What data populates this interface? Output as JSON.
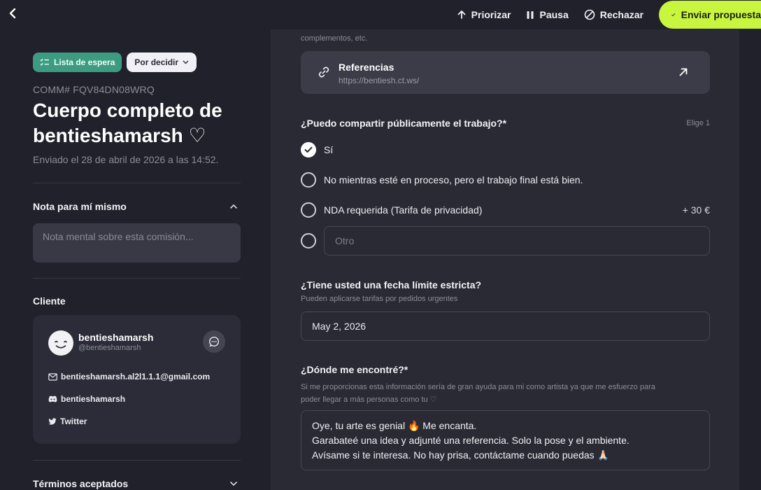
{
  "topbar": {
    "actions": {
      "prioritize": "Priorizar",
      "pause": "Pausa",
      "reject": "Rechazar",
      "send": "Enviar propuesta"
    }
  },
  "commission": {
    "badge_status": "Lista de espera",
    "badge_decision": "Por decidir",
    "id": "COMM# FQV84DN08WRQ",
    "title": "Cuerpo completo de bentieshamarsh ♡",
    "sent": "Enviado el 28 de abril de 2026 a las 14:52."
  },
  "note": {
    "heading": "Nota para mí mismo",
    "placeholder": "Nota mental sobre esta comisión..."
  },
  "client": {
    "heading": "Cliente",
    "name": "bentieshamarsh",
    "handle": "@bentieshamarsh",
    "email": "bentieshamarsh.al2l1.1.1@gmail.com",
    "discord": "bentieshamarsh",
    "twitter": "Twitter"
  },
  "terms": {
    "heading": "Términos aceptados"
  },
  "form": {
    "cut_text": "complementos, etc.",
    "reference": {
      "title": "Referencias",
      "url": "https://bentiesh.ct.ws/"
    },
    "share": {
      "question": "¿Puedo compartir públicamente el trabajo?*",
      "hint": "Elige 1",
      "options": [
        {
          "label": "Sí",
          "selected": true
        },
        {
          "label": "No mientras esté en proceso, pero el trabajo final está bien.",
          "selected": false
        },
        {
          "label": "NDA requerida (Tarifa de privacidad)",
          "selected": false,
          "price": "+ 30 €"
        }
      ],
      "other_placeholder": "Otro"
    },
    "deadline": {
      "question": "¿Tiene usted una fecha límite estricta?",
      "hint": "Pueden aplicarse tarifas por pedidos urgentes",
      "value": "May 2, 2026"
    },
    "found": {
      "question": "¿Dónde me encontré?*",
      "hint_line1": "Si me proporcionas esta información sería de gran ayuda para mi como artista ya que me esfuerzo para",
      "hint_line2": "poder llegar a más personas como tu ♡",
      "answer_line1": "Oye, tu arte es genial 🔥 Me encanta.",
      "answer_line2": "Garabateé una idea y adjunté una referencia. Solo la pose y el ambiente.",
      "answer_line3": "Avísame si te interesa. No hay prisa, contáctame cuando puedas 🙏🏻"
    }
  },
  "colors": {
    "accent": "#c8f53d",
    "badge_green": "#3d9b82",
    "background": "#21212b",
    "panel": "#2a2a35"
  }
}
